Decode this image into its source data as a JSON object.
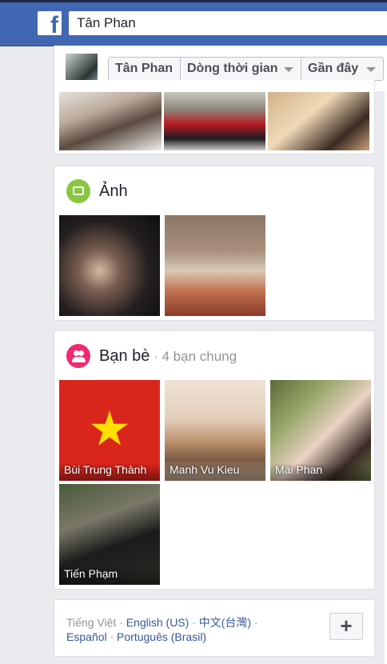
{
  "header": {
    "logo_letter": "f",
    "search_value": "Tân Phan"
  },
  "subheader": {
    "name_tab": "Tân Phan",
    "timeline_tab": "Dòng thời gian",
    "recent_tab": "Gần đây"
  },
  "photos": {
    "title": "Ảnh"
  },
  "friends": {
    "title": "Bạn bè",
    "mutual": " · 4 bạn chung",
    "items": [
      {
        "name": "Bùi Trung Thành"
      },
      {
        "name": "Manh Vu Kieu"
      },
      {
        "name": "Mai Phan"
      },
      {
        "name": "Tiến Phạm"
      }
    ]
  },
  "footer": {
    "current_lang": "Tiếng Việt",
    "sep": " · ",
    "links": [
      "English (US)",
      "中文(台灣)",
      "Español",
      "Português (Brasil)"
    ],
    "add_label": "+"
  },
  "colors": {
    "brand_blue": "#4267b2",
    "link_blue": "#365899",
    "photos_icon": "#8ac640",
    "friends_icon": "#f02870"
  }
}
